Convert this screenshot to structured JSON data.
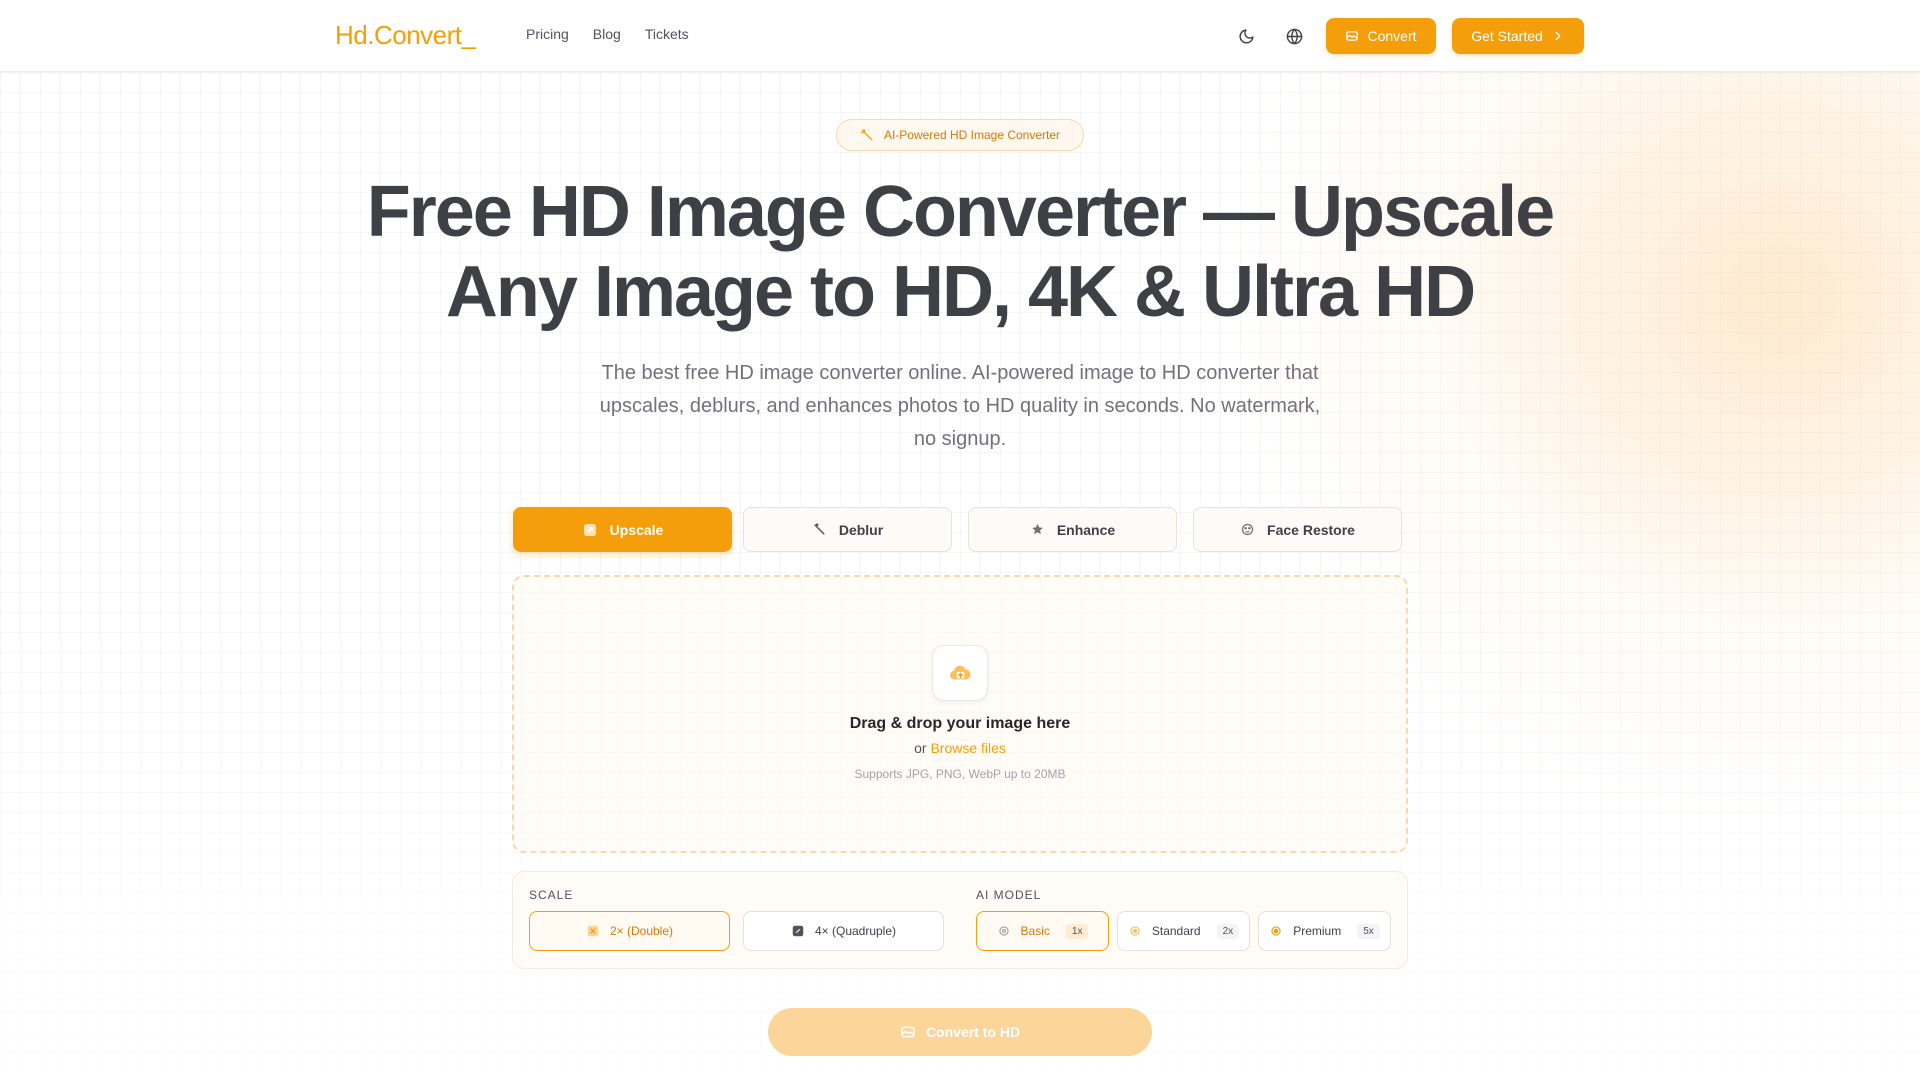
{
  "header": {
    "logo": "Hd.Convert_",
    "nav": [
      {
        "label": "Pricing"
      },
      {
        "label": "Blog"
      },
      {
        "label": "Tickets"
      }
    ],
    "theme_icon": "moon-icon",
    "language_icon": "globe-icon",
    "convert_label": "Convert",
    "get_started_label": "Get Started"
  },
  "hero": {
    "badge": "AI-Powered HD Image Converter",
    "title_line1": "Free HD Image Converter — Upscale",
    "title_line2": "Any Image to HD, 4K & Ultra HD",
    "subtitle": "The best free HD image converter online. AI-powered image to HD converter that upscales, deblurs, and enhances photos to HD quality in seconds. No watermark, no signup."
  },
  "tabs": [
    {
      "label": "Upscale",
      "icon": "upscale-icon",
      "active": true
    },
    {
      "label": "Deblur",
      "icon": "wand-icon",
      "active": false
    },
    {
      "label": "Enhance",
      "icon": "star-icon",
      "active": false
    },
    {
      "label": "Face Restore",
      "icon": "face-scan-icon",
      "active": false
    }
  ],
  "dropzone": {
    "title": "Drag & drop your image here",
    "or_text": "or",
    "browse_label": "Browse files",
    "hint": "Supports JPG, PNG, WebP up to 20MB"
  },
  "options": {
    "scale_label": "SCALE",
    "scale_options": [
      {
        "label": "2× (Double)",
        "selected": true
      },
      {
        "label": "4× (Quadruple)",
        "selected": false
      }
    ],
    "model_label": "AI MODEL",
    "model_options": [
      {
        "label": "Basic",
        "multiplier": "1x",
        "selected": true
      },
      {
        "label": "Standard",
        "multiplier": "2x",
        "selected": false
      },
      {
        "label": "Premium",
        "multiplier": "5x",
        "selected": false
      }
    ]
  },
  "convert_button": "Convert to HD",
  "colors": {
    "accent": "#f59e0b",
    "accent_light": "#fbd59a",
    "text": "#3f3f46"
  }
}
